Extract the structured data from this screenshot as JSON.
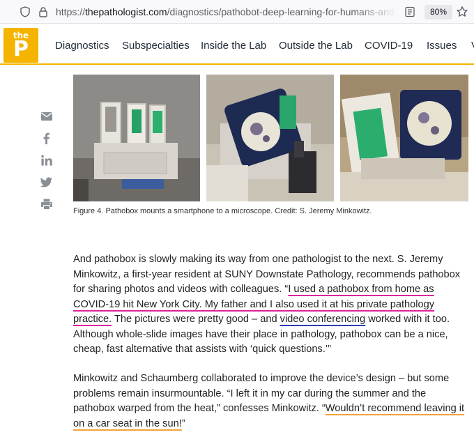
{
  "browser": {
    "url_prefix": "https://",
    "url_host": "thepathologist.com",
    "url_path": "/diagnostics/pathobot-deep-learning-for-humans-and-m",
    "zoom": "80%"
  },
  "site": {
    "logo_small": "the",
    "logo_big": "P",
    "brand_color": "#f4b400",
    "nav": [
      "Diagnostics",
      "Subspecialties",
      "Inside the Lab",
      "Outside the Lab",
      "COVID-19",
      "Issues",
      "V"
    ]
  },
  "share_icons": [
    "email-icon",
    "facebook-icon",
    "linkedin-icon",
    "twitter-icon",
    "print-icon"
  ],
  "figure": {
    "caption": "Figure 4. Pathobox mounts a smartphone to a microscope. Credit: S. Jeremy Minkowitz."
  },
  "article": {
    "p1": {
      "t1": "And pathobox is slowly making its way from one pathologist to the next. S. Jeremy Minkowitz, a first-year resident at SUNY Downstate Pathology, recommends pathobox for sharing photos and videos with colleagues. “",
      "t2": "I used a pathobox from home as COVID-19 hit New York City. My father and I also used it at his private pathology practice.",
      "t3": " The pictures were pretty good – and ",
      "t4": "video conferencing",
      "t5": " worked with it too. Although whole-slide images have their place in pathology, pathobox can be a nice, cheap, fast alternative that assists with ‘quick questions.’”"
    },
    "p2": {
      "t1": "Minkowitz and Schaumberg collaborated to improve the device’s design – but some problems remain insurmountable. “I left it in my car during the summer and the pathobox warped from the heat,” confesses Minkowitz. “",
      "t2": "Wouldn’t recommend leaving it on a car seat in the sun!",
      "t3": "”"
    },
    "highlight_colors": {
      "pink": "#e0219e",
      "blue": "#2e3bb8",
      "orange": "#f2a33a"
    }
  }
}
